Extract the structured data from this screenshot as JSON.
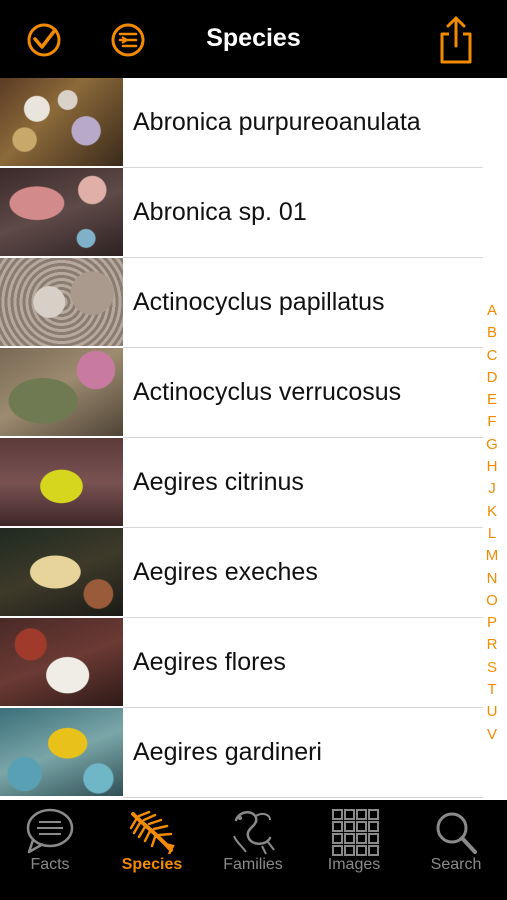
{
  "nav": {
    "title": "Species"
  },
  "species": [
    {
      "name": "Abronica purpureoanulata"
    },
    {
      "name": "Abronica sp. 01"
    },
    {
      "name": "Actinocyclus papillatus"
    },
    {
      "name": "Actinocyclus verrucosus"
    },
    {
      "name": "Aegires citrinus"
    },
    {
      "name": "Aegires exeches"
    },
    {
      "name": "Aegires flores"
    },
    {
      "name": "Aegires gardineri"
    }
  ],
  "index_letters": [
    "A",
    "B",
    "C",
    "D",
    "E",
    "F",
    "G",
    "H",
    "J",
    "K",
    "L",
    "M",
    "N",
    "O",
    "P",
    "R",
    "S",
    "T",
    "U",
    "V"
  ],
  "tabs": [
    {
      "label": "Facts",
      "icon": "speech-bubble-icon"
    },
    {
      "label": "Species",
      "icon": "nudibranch-icon"
    },
    {
      "label": "Families",
      "icon": "family-sketch-icon"
    },
    {
      "label": "Images",
      "icon": "grid-icon"
    },
    {
      "label": "Search",
      "icon": "magnifier-icon"
    }
  ],
  "colors": {
    "accent": "#f28b00",
    "inactive": "#8a8a8a",
    "bar": "#000000"
  }
}
